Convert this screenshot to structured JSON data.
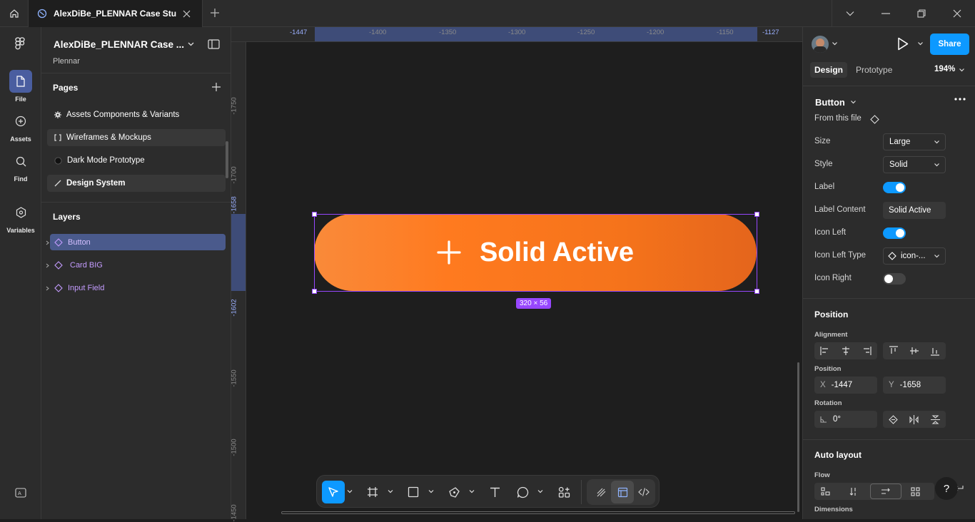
{
  "titlebar": {
    "tab_title": "AlexDiBe_PLENNAR Case Study P",
    "icons": [
      "home-icon",
      "figma-file-icon",
      "close-icon",
      "plus-icon",
      "chevron-down-icon",
      "minimize-icon",
      "maximize-icon",
      "close-icon"
    ]
  },
  "rail": {
    "items": [
      {
        "label": "File",
        "icon": "file-icon"
      },
      {
        "label": "Assets",
        "icon": "assets-icon"
      },
      {
        "label": "Find",
        "icon": "search-icon"
      },
      {
        "label": "Variables",
        "icon": "variables-icon"
      }
    ]
  },
  "left_panel": {
    "file_title": "AlexDiBe_PLENNAR Case ...",
    "file_subtitle": "Plennar",
    "pages_header": "Pages",
    "pages": [
      {
        "label": "Assets Components & Variants",
        "icon": "gear-icon"
      },
      {
        "label": "Wireframes & Mockups",
        "icon": "bracket-icon"
      },
      {
        "label": "Dark Mode Prototype",
        "icon": "circle-icon"
      },
      {
        "label": "Design System",
        "icon": "pen-line-icon"
      }
    ],
    "layers_header": "Layers",
    "layers": [
      {
        "label": "Button",
        "selected": true
      },
      {
        "label": "Card BIG",
        "selected": false
      },
      {
        "label": "Input Field",
        "selected": false
      }
    ]
  },
  "canvas": {
    "ruler_top": [
      "-1447",
      "-1400",
      "-1350",
      "-1300",
      "-1250",
      "-1200",
      "-1150",
      "-1127"
    ],
    "ruler_left": [
      "-1750",
      "-1700",
      "-1658",
      "-1602",
      "-1550",
      "-1500",
      "-1450"
    ],
    "button_label": "Solid Active",
    "dimensions": "320 × 56",
    "button_gradient": [
      "#f98a3a",
      "#ff7a1f",
      "#e4651c"
    ],
    "selection_color": "#9747ff"
  },
  "toolbar": {
    "tools": [
      "move-icon",
      "frame-icon",
      "rectangle-icon",
      "pen-icon",
      "text-icon",
      "comment-icon",
      "actions-icon",
      "draw-icon",
      "design-mode-icon",
      "dev-mode-icon"
    ]
  },
  "right_panel": {
    "share_label": "Share",
    "tab_design": "Design",
    "tab_prototype": "Prototype",
    "zoom": "194%",
    "component_name": "Button",
    "component_source": "From this file",
    "properties": {
      "size_label": "Size",
      "size_value": "Large",
      "style_label": "Style",
      "style_value": "Solid",
      "label_label": "Label",
      "label_on": true,
      "label_content_label": "Label Content",
      "label_content_value": "Solid Active",
      "icon_left_label": "Icon Left",
      "icon_left_on": true,
      "icon_left_type_label": "Icon Left Type",
      "icon_left_type_value": "icon-...",
      "icon_right_label": "Icon Right",
      "icon_right_on": false
    },
    "position_header": "Position",
    "alignment_label": "Alignment",
    "position_label": "Position",
    "x_label": "X",
    "x_value": "-1447",
    "y_label": "Y",
    "y_value": "-1658",
    "rotation_label": "Rotation",
    "rotation_value": "0°",
    "auto_layout_header": "Auto layout",
    "flow_label": "Flow",
    "dimensions_label": "Dimensions",
    "help_label": "?",
    "accent": "#0d99ff"
  }
}
